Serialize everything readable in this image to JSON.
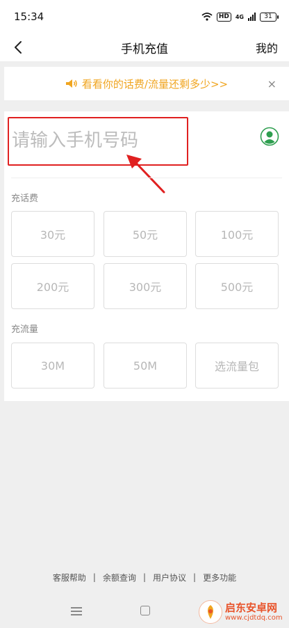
{
  "status_bar": {
    "time": "15:34",
    "hd": "HD",
    "network": "4G",
    "battery": "31"
  },
  "nav": {
    "title": "手机充值",
    "mine_label": "我的"
  },
  "banner": {
    "text": "看看你的话费/流量还剩多少>>",
    "close": "×"
  },
  "phone": {
    "placeholder": "请输入手机号码",
    "value": ""
  },
  "recharge_call": {
    "label": "充话费",
    "options": [
      "30元",
      "50元",
      "100元",
      "200元",
      "300元",
      "500元"
    ]
  },
  "recharge_data": {
    "label": "充流量",
    "options": [
      "30M",
      "50M",
      "选流量包"
    ]
  },
  "footer": {
    "links": [
      "客服帮助",
      "余额查询",
      "用户协议",
      "更多功能"
    ],
    "separator": "|"
  },
  "watermark": {
    "title": "启东安卓网",
    "url": "www.cjdtdq.com"
  },
  "colors": {
    "accent_orange": "#f0a520",
    "highlight_red": "#e02020",
    "contact_green": "#2e9e4f"
  },
  "icons": {
    "back": "chevron-left-icon",
    "speaker": "speaker-icon",
    "contact": "contact-icon"
  }
}
